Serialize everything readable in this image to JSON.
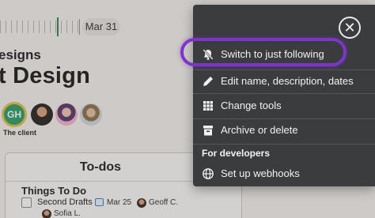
{
  "timeline": {
    "date": "Mar 31"
  },
  "project": {
    "subtitle": "esigns",
    "title": "t Design"
  },
  "people": {
    "client_initials": "GH",
    "client_label": "The client"
  },
  "todos": {
    "card_title": "To-dos",
    "list_title": "Things To Do",
    "item": {
      "name": "Second Drafts",
      "due": "Mar 25",
      "assignees": [
        "Geoff C.",
        "Sofia L."
      ]
    }
  },
  "menu": {
    "items": [
      {
        "label": "Switch to just following",
        "icon": "bell-off-icon"
      },
      {
        "label": "Edit name, description, dates",
        "icon": "pencil-icon"
      },
      {
        "label": "Change tools",
        "icon": "grid-icon"
      },
      {
        "label": "Archive or delete",
        "icon": "archive-icon"
      }
    ],
    "developers_heading": "For developers",
    "developer_items": [
      {
        "label": "Set up webhooks",
        "icon": "globe-icon"
      }
    ]
  },
  "colors": {
    "menu_bg": "#3a3c3e",
    "highlight": "#7d35c9",
    "client_avatar": "#2f9e6a",
    "timeline_marker": "#2b8a4b"
  }
}
